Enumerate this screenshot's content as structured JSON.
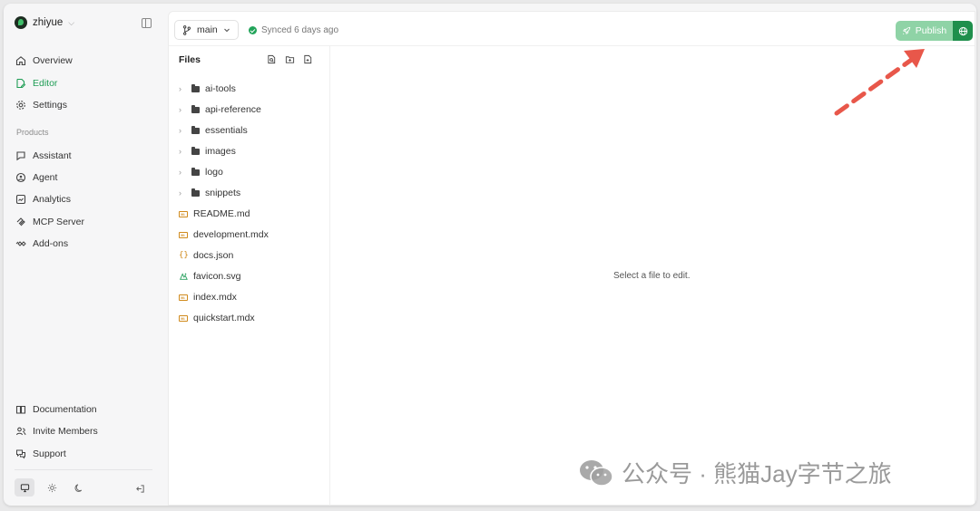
{
  "org": {
    "name": "zhiyue"
  },
  "nav": [
    {
      "label": "Overview",
      "icon": "home-icon",
      "active": false
    },
    {
      "label": "Editor",
      "icon": "edit-file-icon",
      "active": true
    },
    {
      "label": "Settings",
      "icon": "gear-icon",
      "active": false
    }
  ],
  "products": {
    "label": "Products",
    "items": [
      {
        "label": "Assistant",
        "icon": "chat-icon"
      },
      {
        "label": "Agent",
        "icon": "agent-icon"
      },
      {
        "label": "Analytics",
        "icon": "analytics-icon"
      },
      {
        "label": "MCP Server",
        "icon": "mcp-icon"
      },
      {
        "label": "Add-ons",
        "icon": "addons-icon"
      }
    ]
  },
  "footer_nav": [
    {
      "label": "Documentation",
      "icon": "book-icon"
    },
    {
      "label": "Invite Members",
      "icon": "users-icon"
    },
    {
      "label": "Support",
      "icon": "support-icon"
    }
  ],
  "topbar": {
    "branch": "main",
    "sync_status": "Synced 6 days ago",
    "publish_label": "Publish"
  },
  "files": {
    "title": "Files",
    "folders": [
      "ai-tools",
      "api-reference",
      "essentials",
      "images",
      "logo",
      "snippets"
    ],
    "items": [
      {
        "name": "README.md",
        "type": "md"
      },
      {
        "name": "development.mdx",
        "type": "md"
      },
      {
        "name": "docs.json",
        "type": "json"
      },
      {
        "name": "favicon.svg",
        "type": "svg"
      },
      {
        "name": "index.mdx",
        "type": "md"
      },
      {
        "name": "quickstart.mdx",
        "type": "md"
      }
    ]
  },
  "editor": {
    "empty_text": "Select a file to edit."
  },
  "watermark": {
    "text": "公众号 · 熊猫Jay字节之旅"
  },
  "colors": {
    "accent": "#1f9d55",
    "publish_bg": "#8fd3a6",
    "publish_globe": "#1f8f4c",
    "annotation_arrow": "#e8574a"
  }
}
